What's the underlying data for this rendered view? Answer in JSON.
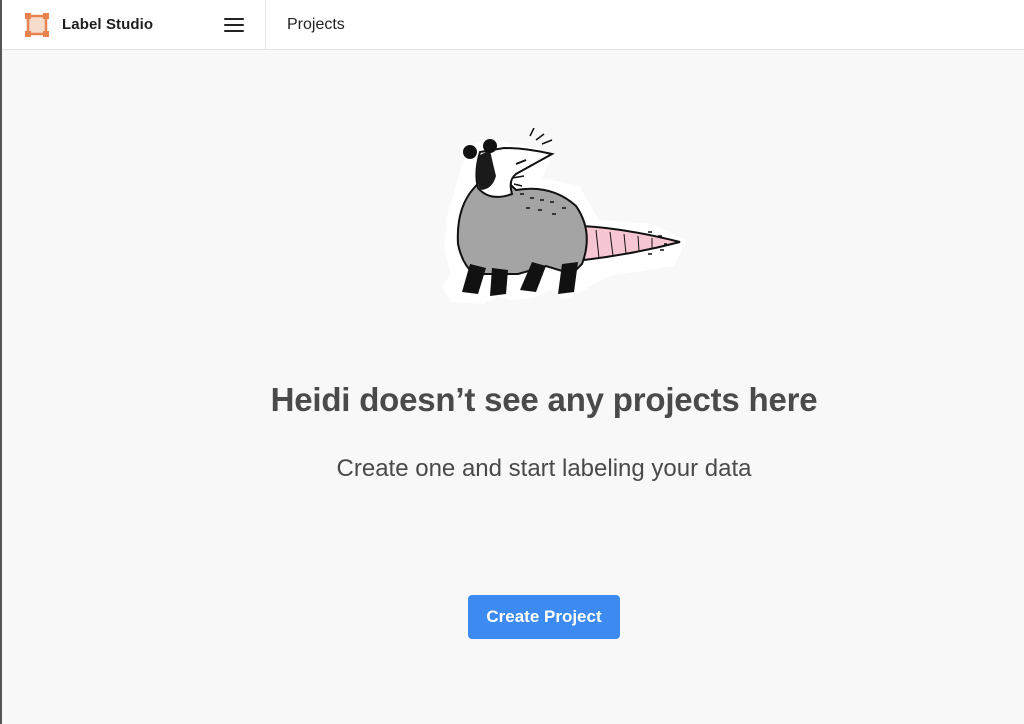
{
  "app": {
    "name": "Label Studio"
  },
  "header": {
    "breadcrumb": "Projects",
    "menu_icon": "hamburger-menu-icon",
    "logo_icon": "label-studio-logo-icon"
  },
  "empty_state": {
    "illustration": "opossum-illustration",
    "title": "Heidi doesn’t see any projects here",
    "subtitle": "Create one and start labeling your data",
    "cta_label": "Create Project"
  },
  "colors": {
    "primary": "#3d8bf0",
    "logo": "#e8834f",
    "background": "#f8f8f8"
  }
}
